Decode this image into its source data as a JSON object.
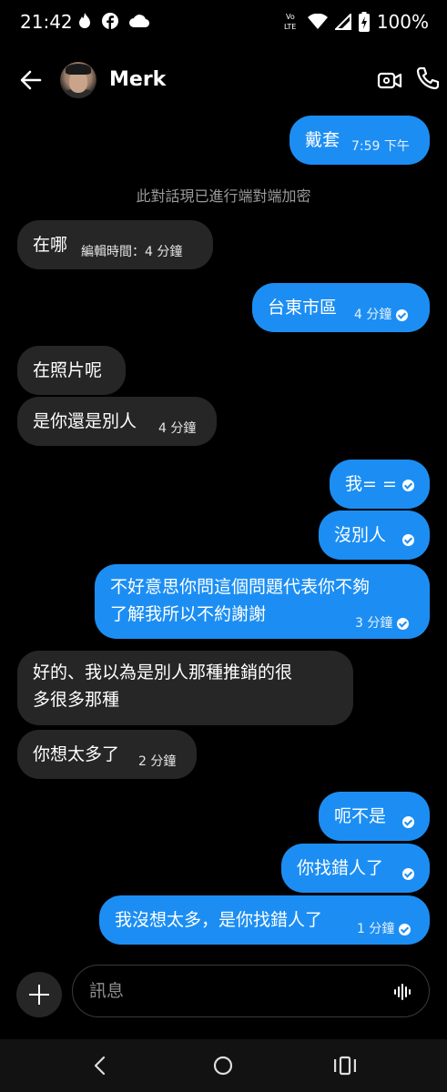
{
  "status_bar": {
    "time": "21:42",
    "battery": "100%",
    "icons": [
      "flame-icon",
      "facebook-icon",
      "cloud-icon",
      "volte-icon",
      "wifi-icon",
      "signal-icon",
      "battery-icon"
    ]
  },
  "header": {
    "contact_name": "Merk",
    "icons": [
      "back-arrow-icon",
      "video-call-icon",
      "phone-icon"
    ]
  },
  "notice": "此對話現已進行端對端加密",
  "messages": [
    {
      "dir": "out",
      "text": "戴套",
      "time": "7:59 下午",
      "check": false
    },
    {
      "dir": "in",
      "text": "在哪",
      "time": "編輯時間：4 分鐘"
    },
    {
      "dir": "out",
      "text": "台東市區",
      "time": "4 分鐘",
      "check": true
    },
    {
      "dir": "in",
      "text": "在照片呢",
      "time": ""
    },
    {
      "dir": "in",
      "text": "是你還是別人",
      "time": "4 分鐘"
    },
    {
      "dir": "out",
      "text": "我= =",
      "time": "",
      "check": true
    },
    {
      "dir": "out",
      "text": "沒別人",
      "time": "",
      "check": true
    },
    {
      "dir": "out",
      "text_line1": "不好意思你問這個問題代表你不夠",
      "text_line2": "了解我所以不約謝謝",
      "time": "3 分鐘",
      "check": true
    },
    {
      "dir": "in",
      "text_line1": "好的、我以為是別人那種推銷的很",
      "text_line2": "多很多那種",
      "time": ""
    },
    {
      "dir": "in",
      "text": "你想太多了",
      "time": "2 分鐘"
    },
    {
      "dir": "out",
      "text": "呃不是",
      "time": "",
      "check": true
    },
    {
      "dir": "out",
      "text": "你找錯人了",
      "time": "",
      "check": true
    },
    {
      "dir": "out",
      "text": "我沒想太多，是你找錯人了",
      "time": "1 分鐘",
      "check": true
    }
  ],
  "composer": {
    "placeholder": "訊息"
  },
  "colors": {
    "background": "#000000",
    "outgoing_bubble": "#1c8ef3",
    "incoming_bubble": "#262626"
  }
}
